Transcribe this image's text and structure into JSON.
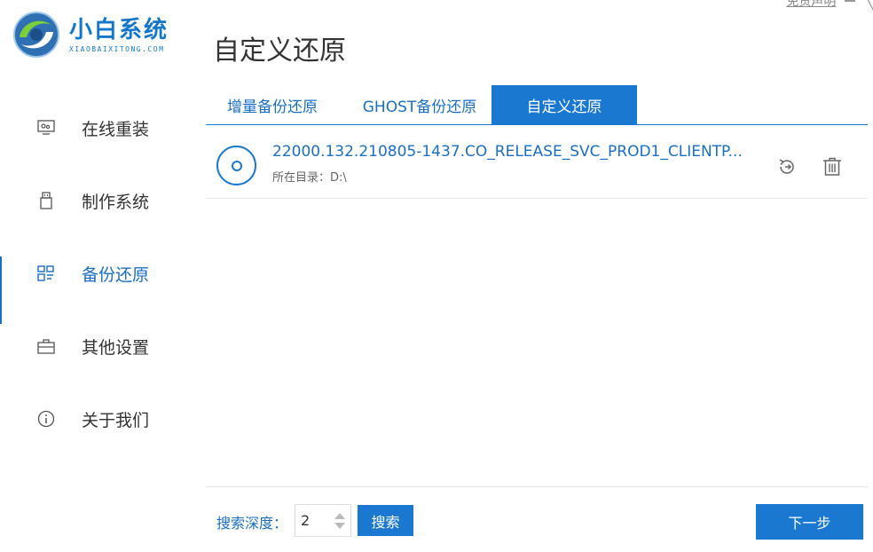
{
  "app": {
    "name_cn": "小白系统",
    "name_en": "XIAOBAIXITONG.COM",
    "disclaimer": "免责声明"
  },
  "page_title": "自定义还原",
  "sidebar": {
    "items": [
      {
        "label": "在线重装",
        "icon": "monitor-icon"
      },
      {
        "label": "制作系统",
        "icon": "usb-icon"
      },
      {
        "label": "备份还原",
        "icon": "backup-icon",
        "active": true
      },
      {
        "label": "其他设置",
        "icon": "briefcase-icon"
      },
      {
        "label": "关于我们",
        "icon": "info-icon"
      }
    ]
  },
  "tabs": [
    {
      "label": "增量备份还原"
    },
    {
      "label": "GHOST备份还原"
    },
    {
      "label": "自定义还原",
      "active": true
    }
  ],
  "file": {
    "name": "22000.132.210805-1437.CO_RELEASE_SVC_PROD1_CLIENTP...",
    "dir": "所在目录：D:\\"
  },
  "footer": {
    "depth_label": "搜索深度：",
    "depth_value": "2",
    "search_label": "搜索",
    "next_label": "下一步"
  },
  "colors": {
    "accent": "#1a78d0",
    "brand": "#1577c9",
    "text": "#333333"
  }
}
